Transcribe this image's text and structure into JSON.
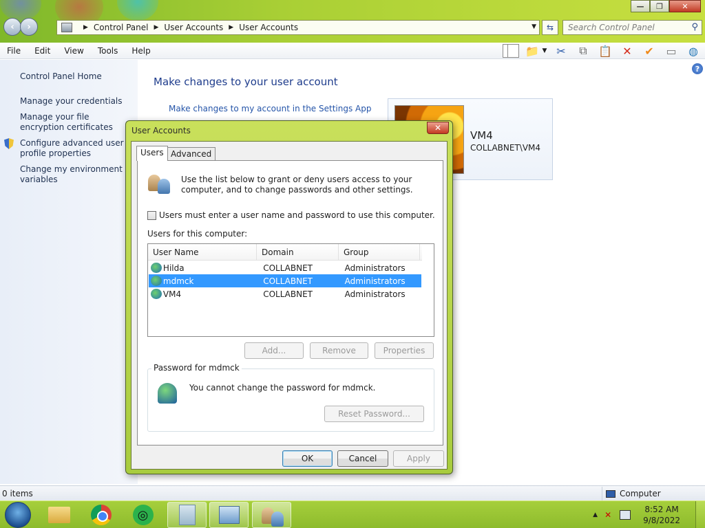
{
  "window": {
    "minimize_label": "—",
    "maximize_label": "❐",
    "close_label": "✕"
  },
  "address": {
    "crumbs": [
      "Control Panel",
      "User Accounts",
      "User Accounts"
    ],
    "search_placeholder": "Search Control Panel"
  },
  "menu": [
    "File",
    "Edit",
    "View",
    "Tools",
    "Help"
  ],
  "sidebar": {
    "items": [
      "Control Panel Home",
      "Manage your credentials",
      "Manage your file encryption certificates",
      "Configure advanced user profile properties",
      "Change my environment variables"
    ]
  },
  "main": {
    "title": "Make changes to your user account",
    "settings_link": "Make changes to my account in the Settings App",
    "account_name": "VM4",
    "account_domain": "COLLABNET\\VM4"
  },
  "dialog": {
    "title": "User Accounts",
    "tabs": [
      "Users",
      "Advanced"
    ],
    "intro": "Use the list below to grant or deny users access to your computer, and to change passwords and other settings.",
    "checkbox_label": "Users must enter a user name and password to use this computer.",
    "checkbox_checked": false,
    "users_label": "Users for this computer:",
    "columns": [
      "User Name",
      "Domain",
      "Group"
    ],
    "rows": [
      {
        "name": "Hilda",
        "domain": "COLLABNET",
        "group": "Administrators"
      },
      {
        "name": "mdmck",
        "domain": "COLLABNET",
        "group": "Administrators"
      },
      {
        "name": "VM4",
        "domain": "COLLABNET",
        "group": "Administrators"
      }
    ],
    "selected_row": "mdmck",
    "btn_add": "Add...",
    "btn_remove": "Remove",
    "btn_properties": "Properties",
    "password_group_title": "Password for mdmck",
    "password_text": "You cannot change the password for mdmck.",
    "btn_reset": "Reset Password...",
    "btn_ok": "OK",
    "btn_cancel": "Cancel",
    "btn_apply": "Apply"
  },
  "status": {
    "items": "0 items",
    "location": "Computer"
  },
  "taskbar": {
    "time": "8:52 AM",
    "date": "9/8/2022"
  }
}
